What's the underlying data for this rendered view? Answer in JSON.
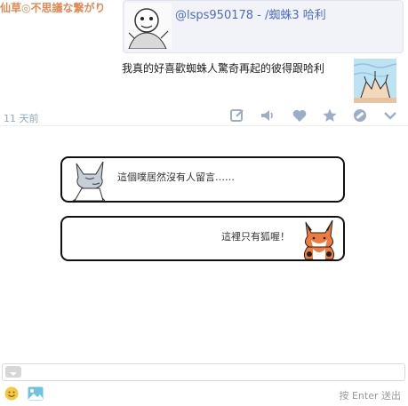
{
  "post": {
    "user_name": "仙草◎不思議な繋がり",
    "share_title": "@lsps950178 - /蜘蛛3 哈利",
    "text": "我真的好喜歡蜘蛛人驚奇再起的彼得跟哈利",
    "time": "11 天前"
  },
  "actions": [
    {
      "name": "edit-icon"
    },
    {
      "name": "speaker-icon"
    },
    {
      "name": "heart-icon"
    },
    {
      "name": "star-icon"
    },
    {
      "name": "block-icon"
    },
    {
      "name": "chevron-down-icon"
    }
  ],
  "empty_state": {
    "wolf_message": "這個噗居然沒有人留言……",
    "fox_message": "這裡只有狐喔！"
  },
  "composer": {
    "send_hint": "按 Enter 送出"
  },
  "colors": {
    "user_name": "#e08a55",
    "link": "#4b6ebf",
    "action_icons": "#9cadc7"
  }
}
